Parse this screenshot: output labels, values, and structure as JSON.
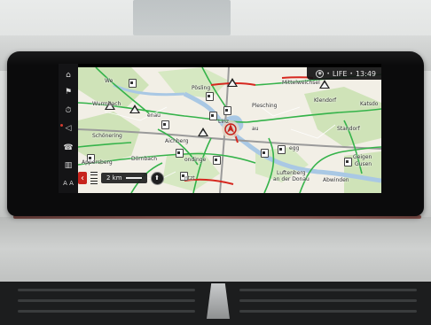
{
  "status_bar": {
    "compass_icon": "compass-circle-icon",
    "radio_label": "LIFE",
    "time": "13:49",
    "dot": "•"
  },
  "side_menu": [
    {
      "icon": "home-icon",
      "glyph": "⌂"
    },
    {
      "icon": "destination-flag-icon",
      "glyph": "⚑"
    },
    {
      "icon": "clock-icon",
      "glyph": "⏱"
    },
    {
      "icon": "speaker-icon",
      "glyph": "◁"
    },
    {
      "icon": "phone-bt-icon",
      "glyph": "☎"
    },
    {
      "icon": "map-book-icon",
      "glyph": "▥"
    },
    {
      "icon": "font-size-icon",
      "glyph": "A A"
    }
  ],
  "map_labels": {
    "wenzenbach": "We",
    "poesling": "Pösling",
    "mittelweichsel": "Mittelweichsel",
    "kleindorf": "Klendorf",
    "katzdorf": "Katsdo",
    "pfaffenberg": "Wurmbach",
    "schoenering": "Schönering",
    "aichberg": "Aichberg",
    "doernbach": "Dörnbach",
    "apersberg": "Appersberg",
    "standorf": "Standorf",
    "geigen": "Geigen",
    "gusen": "Gusen",
    "abwinden": "Abwinden",
    "luftenberg": "Luftenberg",
    "an_der_donau": "an der Donau",
    "plesching": "Plesching",
    "linz": "Linz",
    "traun": "Traun",
    "enau": "enau",
    "pegg": "egg",
    "au": "au",
    "leondingen": "ondinge",
    "ntzt": "ntzt"
  },
  "scale": {
    "back_glyph": "‹",
    "distance": "2 km",
    "compass_glyph": "⬆"
  },
  "colors": {
    "map_land": "#f2efe6",
    "forest": "#cfe3b8",
    "water": "#a9c8e4",
    "traffic_green": "#35b34a",
    "traffic_red": "#d6281f",
    "motorway": "#9a9a9a"
  }
}
